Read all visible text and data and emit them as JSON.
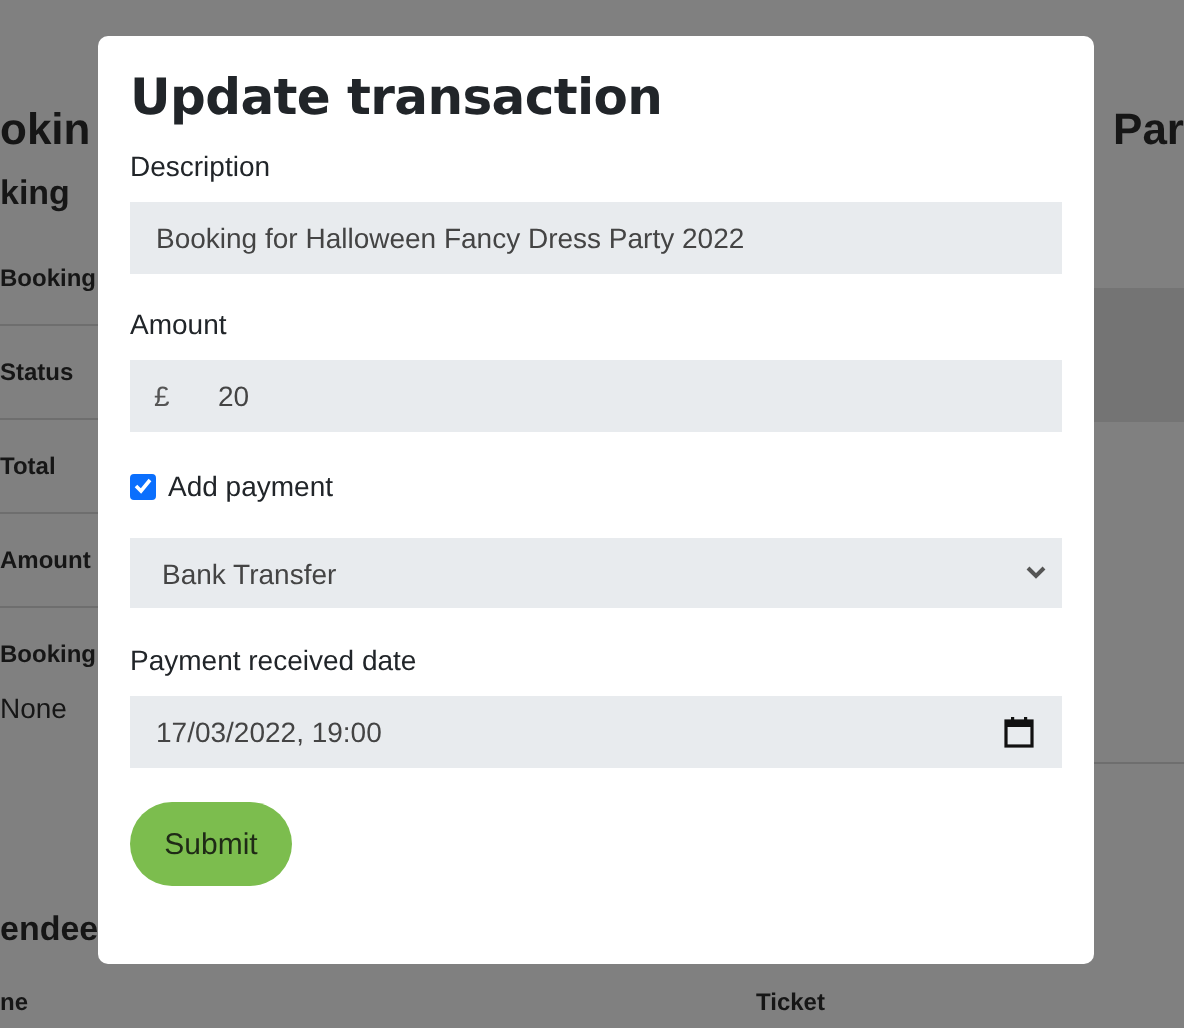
{
  "background_page": {
    "heading_left": "okin",
    "heading_right": "Par",
    "section_heading": "king",
    "detail_labels": [
      "Booking",
      "Status",
      "Total",
      "Amount",
      "Booking"
    ],
    "detail_value": "None",
    "attendees_heading": "endee",
    "table_columns": [
      "ne",
      "Ticket"
    ]
  },
  "modal": {
    "title": "Update transaction",
    "fields": [
      {
        "kind": "text",
        "label": "Description",
        "value": "Booking for Halloween Fancy Dress Party 2022"
      },
      {
        "kind": "currency",
        "label": "Amount",
        "prefix": "£",
        "value": "20"
      },
      {
        "kind": "checkbox",
        "label": "Add payment",
        "checked": true
      },
      {
        "kind": "select",
        "value": "Bank Transfer"
      },
      {
        "kind": "datetime",
        "label": "Payment received date",
        "value": "17/03/2022, 19:00"
      }
    ],
    "submit": "Submit"
  }
}
